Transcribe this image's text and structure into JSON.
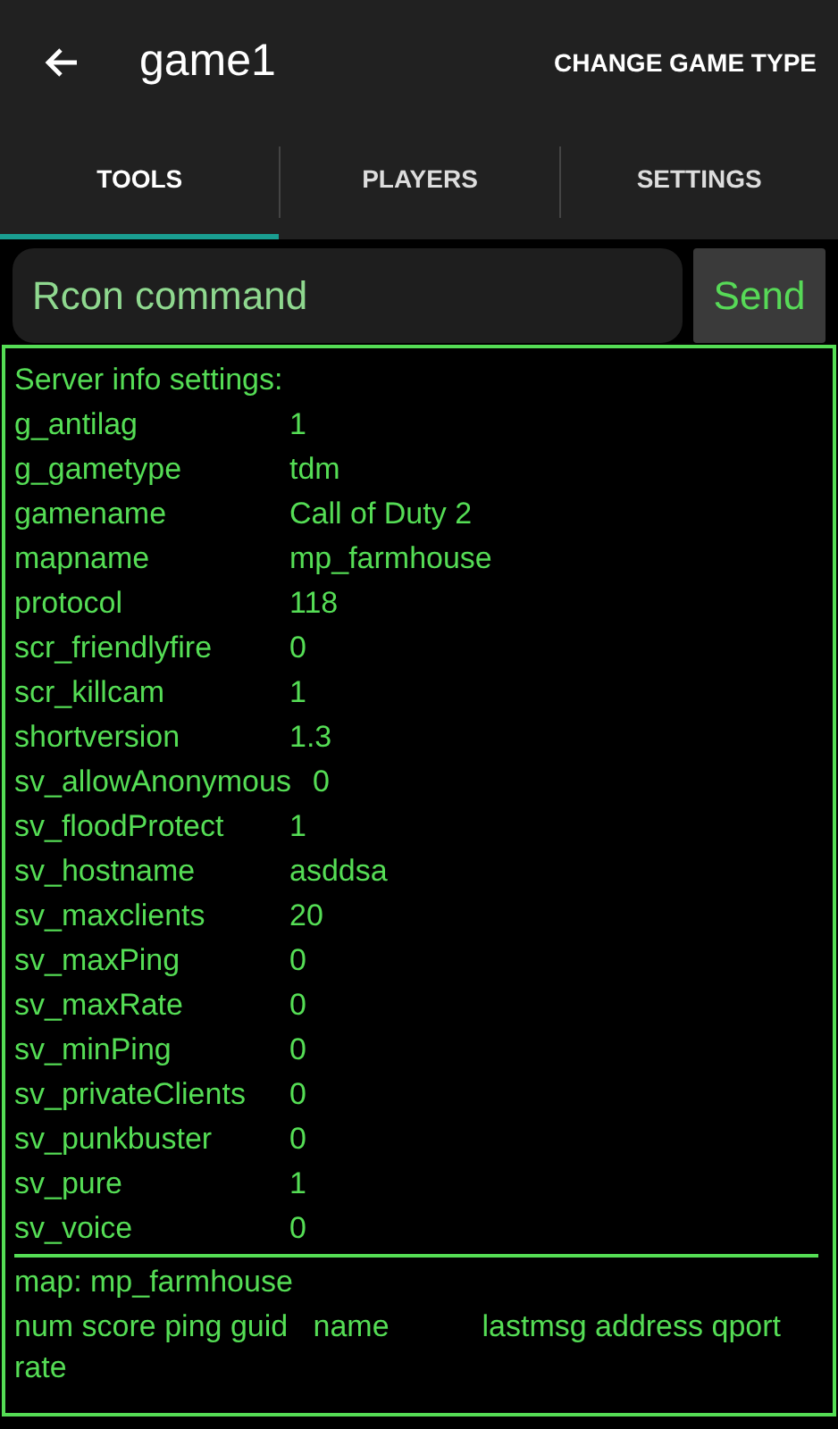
{
  "app_bar": {
    "title": "game1",
    "action": "CHANGE GAME TYPE"
  },
  "tabs": [
    {
      "label": "TOOLS",
      "selected": true
    },
    {
      "label": "PLAYERS",
      "selected": false
    },
    {
      "label": "SETTINGS",
      "selected": false
    }
  ],
  "command": {
    "placeholder": "Rcon command",
    "button": "Send"
  },
  "output": {
    "heading": "Server info settings:",
    "settings": [
      {
        "key": "g_antilag",
        "value": "1"
      },
      {
        "key": "g_gametype",
        "value": "tdm"
      },
      {
        "key": "gamename",
        "value": "Call of Duty 2"
      },
      {
        "key": "mapname",
        "value": "mp_farmhouse"
      },
      {
        "key": "protocol",
        "value": "118"
      },
      {
        "key": "scr_friendlyfire",
        "value": "0"
      },
      {
        "key": "scr_killcam",
        "value": "1"
      },
      {
        "key": "shortversion",
        "value": "1.3"
      },
      {
        "key": "sv_allowAnonymous",
        "value": "0"
      },
      {
        "key": "sv_floodProtect",
        "value": "1"
      },
      {
        "key": "sv_hostname",
        "value": "asddsa"
      },
      {
        "key": "sv_maxclients",
        "value": "20"
      },
      {
        "key": "sv_maxPing",
        "value": "0"
      },
      {
        "key": "sv_maxRate",
        "value": "0"
      },
      {
        "key": "sv_minPing",
        "value": "0"
      },
      {
        "key": "sv_privateClients",
        "value": "0"
      },
      {
        "key": "sv_punkbuster",
        "value": "0"
      },
      {
        "key": "sv_pure",
        "value": "1"
      },
      {
        "key": "sv_voice",
        "value": "0"
      }
    ],
    "status_lines": [
      "map: mp_farmhouse",
      "num score ping guid   name           lastmsg address qport rate"
    ]
  }
}
